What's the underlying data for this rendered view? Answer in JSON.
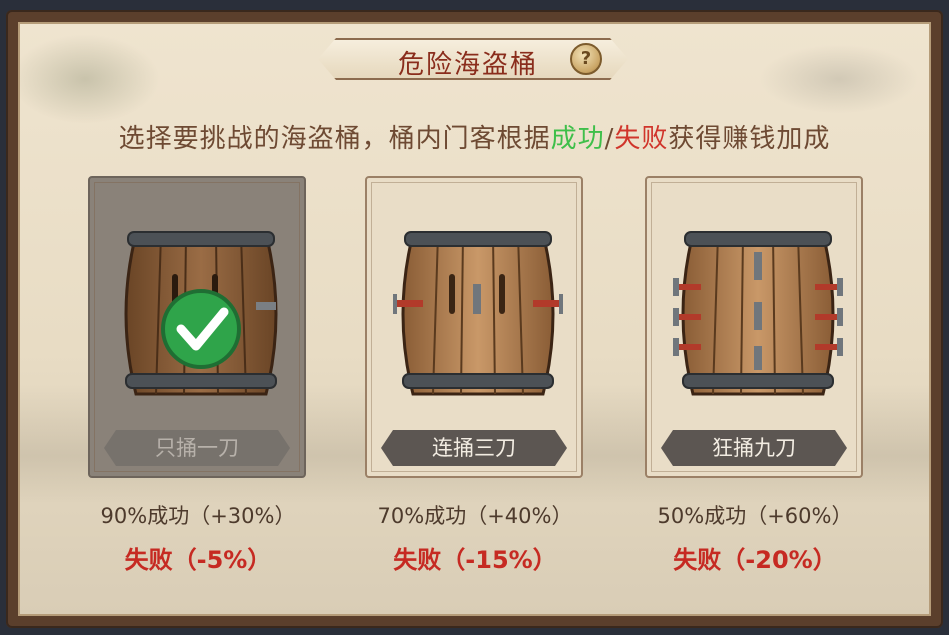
{
  "title": "危险海盗桶",
  "help_glyph": "?",
  "subtitle": {
    "prefix": "选择要挑战的海盗桶，桶内门客根据",
    "success_word": "成功",
    "slash": "/",
    "fail_word": "失败",
    "suffix": "获得赚钱加成"
  },
  "options": [
    {
      "name": "只捅一刀",
      "success_line": "90%成功（+30%）",
      "fail_line": "失败（-5%）",
      "selected": true
    },
    {
      "name": "连捅三刀",
      "success_line": "70%成功（+40%）",
      "fail_line": "失败（-15%）",
      "selected": false
    },
    {
      "name": "狂捅九刀",
      "success_line": "50%成功（+60%）",
      "fail_line": "失败（-20%）",
      "selected": false
    }
  ],
  "colors": {
    "success": "#3fbf4a",
    "fail": "#d0352b",
    "title": "#8a2d1c"
  }
}
